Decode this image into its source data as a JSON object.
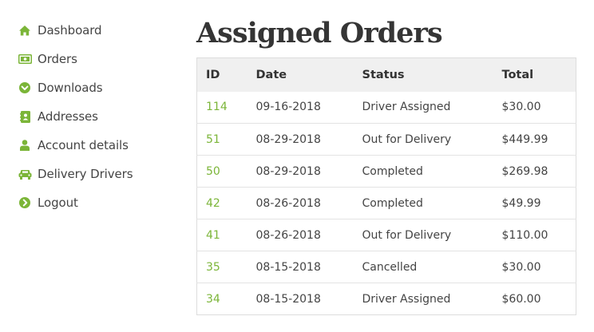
{
  "sidebar": {
    "items": [
      {
        "label": "Dashboard",
        "icon": "home-icon"
      },
      {
        "label": "Orders",
        "icon": "money-icon"
      },
      {
        "label": "Downloads",
        "icon": "download-circle-icon"
      },
      {
        "label": "Addresses",
        "icon": "address-book-icon"
      },
      {
        "label": "Account details",
        "icon": "user-icon"
      },
      {
        "label": "Delivery Drivers",
        "icon": "car-icon"
      },
      {
        "label": "Logout",
        "icon": "logout-arrow-icon"
      }
    ]
  },
  "main": {
    "title": "Assigned Orders",
    "table": {
      "headers": {
        "id": "ID",
        "date": "Date",
        "status": "Status",
        "total": "Total"
      },
      "rows": [
        {
          "id": "114",
          "date": "09-16-2018",
          "status": "Driver Assigned",
          "total": "$30.00"
        },
        {
          "id": "51",
          "date": "08-29-2018",
          "status": "Out for Delivery",
          "total": "$449.99"
        },
        {
          "id": "50",
          "date": "08-29-2018",
          "status": "Completed",
          "total": "$269.98"
        },
        {
          "id": "42",
          "date": "08-26-2018",
          "status": "Completed",
          "total": "$49.99"
        },
        {
          "id": "41",
          "date": "08-26-2018",
          "status": "Out for Delivery",
          "total": "$110.00"
        },
        {
          "id": "35",
          "date": "08-15-2018",
          "status": "Cancelled",
          "total": "$30.00"
        },
        {
          "id": "34",
          "date": "08-15-2018",
          "status": "Driver Assigned",
          "total": "$60.00"
        }
      ]
    }
  },
  "colors": {
    "accent": "#7bb538",
    "header_bg": "#f0f0f0",
    "title": "#353535"
  }
}
